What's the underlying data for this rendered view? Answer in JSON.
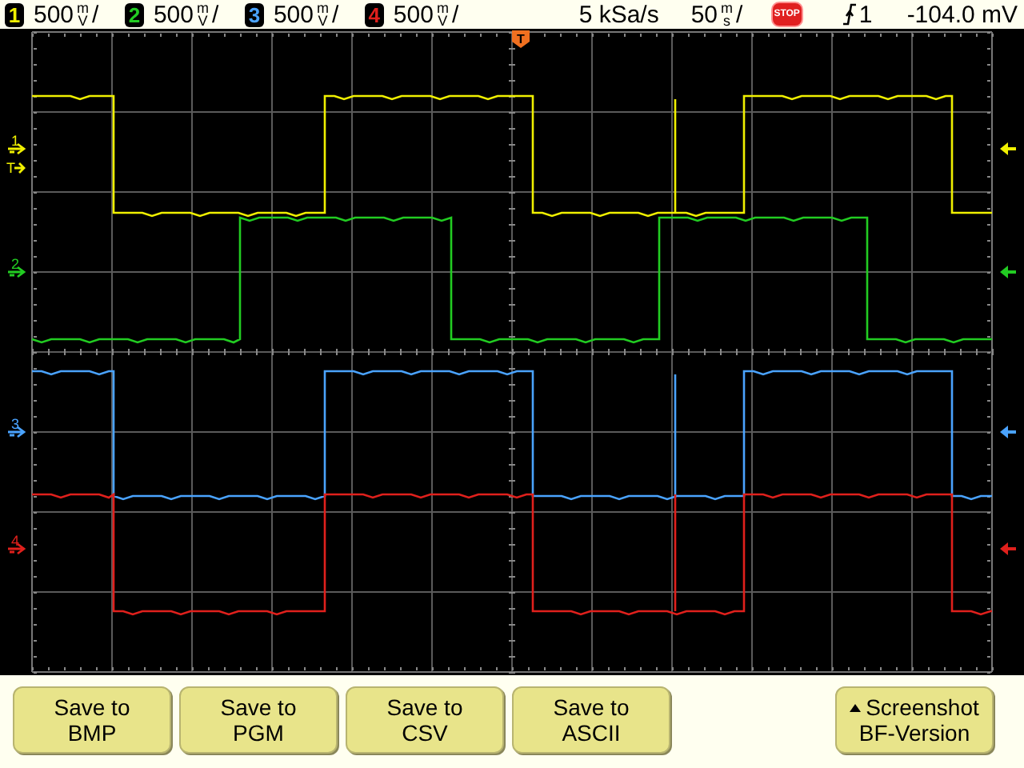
{
  "status_bar": {
    "channels": [
      {
        "number": "1",
        "scale": "500",
        "prefix": "m",
        "unit": "V",
        "separator": "/",
        "color": "#f0f000"
      },
      {
        "number": "2",
        "scale": "500",
        "prefix": "m",
        "unit": "V",
        "separator": "/",
        "color": "#22cc22"
      },
      {
        "number": "3",
        "scale": "500",
        "prefix": "m",
        "unit": "V",
        "separator": "/",
        "color": "#4aa3ff"
      },
      {
        "number": "4",
        "scale": "500",
        "prefix": "m",
        "unit": "V",
        "separator": "/",
        "color": "#e0201c"
      }
    ],
    "sample_rate": "5 kSa/s",
    "timebase": {
      "value": "50",
      "prefix": "m",
      "unit": "s",
      "separator": "/"
    },
    "run_state": "STOP",
    "trigger": {
      "source": "1",
      "level": "-104.0 mV"
    }
  },
  "display": {
    "trigger_position_marker": "T",
    "trigger_level_marker": "T",
    "ground_markers": [
      {
        "label": "1",
        "color": "#f0f000"
      },
      {
        "label": "2",
        "color": "#22cc22"
      },
      {
        "label": "3",
        "color": "#4aa3ff"
      },
      {
        "label": "4",
        "color": "#e0201c"
      }
    ],
    "right_markers": [
      {
        "color": "#f0f000"
      },
      {
        "color": "#22cc22"
      },
      {
        "color": "#4aa3ff"
      },
      {
        "color": "#e0201c"
      }
    ],
    "traces": [
      {
        "color": "#f0f000"
      },
      {
        "color": "#22cc22"
      },
      {
        "color": "#4aa3ff"
      },
      {
        "color": "#e0201c"
      }
    ]
  },
  "softkeys": [
    {
      "lines": [
        "Save to",
        "BMP"
      ],
      "kind": "plain"
    },
    {
      "lines": [
        "Save to",
        "PGM"
      ],
      "kind": "plain"
    },
    {
      "lines": [
        "Save to",
        "CSV"
      ],
      "kind": "plain"
    },
    {
      "lines": [
        "Save to",
        "ASCII"
      ],
      "kind": "plain"
    },
    {
      "lines": [
        "Screenshot",
        "BF-Version"
      ],
      "kind": "menu"
    }
  ]
}
